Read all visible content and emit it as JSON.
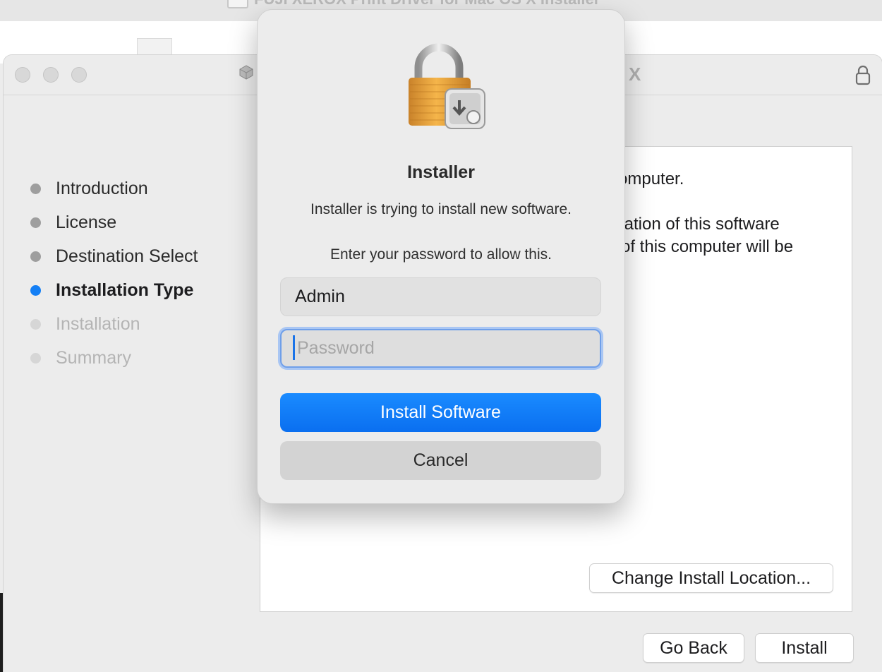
{
  "background_window": {
    "title": "FUJI XEROX Print Driver for Mac OS X Installer"
  },
  "window": {
    "title_visible_fragment": "X"
  },
  "steps": [
    {
      "label": "Introduction",
      "state": "done"
    },
    {
      "label": "License",
      "state": "done"
    },
    {
      "label": "Destination Select",
      "state": "done"
    },
    {
      "label": "Installation Type",
      "state": "current"
    },
    {
      "label": "Installation",
      "state": "todo"
    },
    {
      "label": "Summary",
      "state": "todo"
    }
  ],
  "content": {
    "line1": "omputer.",
    "line2": "llation of this software",
    "line3": "of this computer will be",
    "change_location_label": "Change Install Location..."
  },
  "footer": {
    "go_back_label": "Go Back",
    "install_label": "Install"
  },
  "dialog": {
    "title": "Installer",
    "message": "Installer is trying to install new software.",
    "prompt": "Enter your password to allow this.",
    "username_value": "Admin",
    "password_placeholder": "Password",
    "install_button_label": "Install Software",
    "cancel_button_label": "Cancel"
  },
  "colors": {
    "accent": "#147ff5",
    "primary_button": "#0a6ff0",
    "lock_gold": "#e9a23b"
  },
  "icons": [
    "lock-icon",
    "padlock-installer-icon",
    "package-icon",
    "document-icon"
  ]
}
